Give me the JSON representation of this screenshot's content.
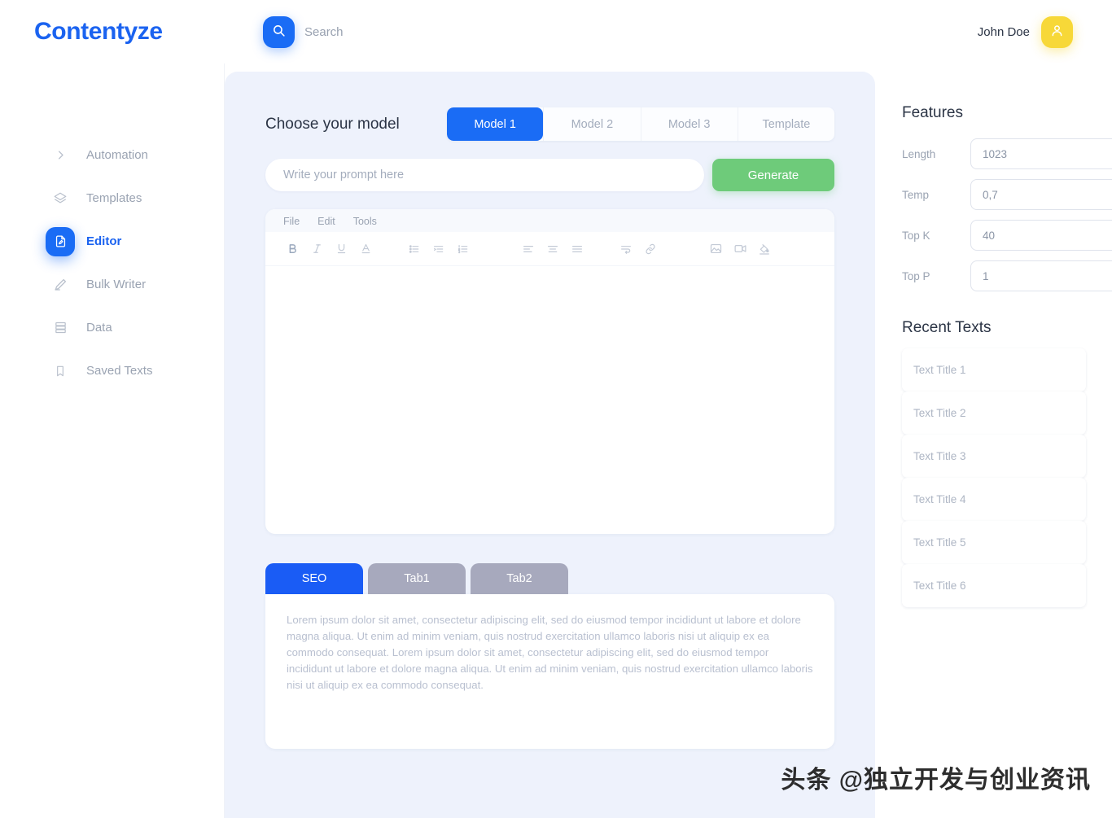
{
  "header": {
    "brand": "Contentyze",
    "search_placeholder": "Search",
    "search_value": "",
    "search_icon": "search-icon",
    "user_name": "John Doe",
    "avatar_icon": "user-icon",
    "brand_color": "#1b63f0",
    "avatar_color": "#f7d838"
  },
  "sidebar": {
    "items": [
      {
        "label": "Automation",
        "icon": "chevron-right-icon",
        "active": false
      },
      {
        "label": "Templates",
        "icon": "layers-icon",
        "active": false
      },
      {
        "label": "Editor",
        "icon": "document-edit-icon",
        "active": true
      },
      {
        "label": "Bulk Writer",
        "icon": "pen-icon",
        "active": false
      },
      {
        "label": "Data",
        "icon": "database-icon",
        "active": false
      },
      {
        "label": "Saved Texts",
        "icon": "bookmark-icon",
        "active": false
      }
    ]
  },
  "main": {
    "model_title": "Choose your model",
    "tabs": [
      {
        "label": "Model 1",
        "active": true
      },
      {
        "label": "Model 2",
        "active": false
      },
      {
        "label": "Model 3",
        "active": false
      },
      {
        "label": "Template",
        "active": false
      }
    ],
    "prompt_placeholder": "Write your prompt here",
    "prompt_value": "",
    "generate_label": "Generate",
    "generate_color": "#6ecb7a",
    "accent_color": "#1a6cf5",
    "editor": {
      "menu": [
        "File",
        "Edit",
        "Tools"
      ],
      "content": "",
      "tools": [
        "bold-icon",
        "italic-icon",
        "underline-icon",
        "text-color-icon",
        "bullet-list-icon",
        "indent-list-icon",
        "numbered-list-icon",
        "align-left-icon",
        "align-center-icon",
        "align-justify-icon",
        "line-wrap-icon",
        "link-icon",
        "image-icon",
        "video-icon",
        "fill-color-icon"
      ]
    },
    "bottom_tabs": [
      {
        "label": "SEO",
        "active": true
      },
      {
        "label": "Tab1",
        "active": false
      },
      {
        "label": "Tab2",
        "active": false
      }
    ],
    "bottom_panel_text": "Lorem ipsum dolor sit amet, consectetur adipiscing elit, sed do eiusmod tempor incididunt ut labore et dolore magna aliqua. Ut enim ad minim veniam, quis nostrud exercitation ullamco laboris nisi ut aliquip ex ea commodo consequat. Lorem ipsum dolor sit amet, consectetur adipiscing elit, sed do eiusmod tempor incididunt ut labore et dolore magna aliqua. Ut enim ad minim veniam, quis nostrud exercitation ullamco laboris nisi ut aliquip ex ea commodo consequat."
  },
  "right": {
    "features_title": "Features",
    "features": [
      {
        "label": "Length",
        "value": "1023"
      },
      {
        "label": "Temp",
        "value": "0,7"
      },
      {
        "label": "Top K",
        "value": "40"
      },
      {
        "label": "Top P",
        "value": "1"
      }
    ],
    "recent_title": "Recent Texts",
    "recent_items": [
      {
        "label": "Text Title 1"
      },
      {
        "label": "Text Title 2"
      },
      {
        "label": "Text Title 3"
      },
      {
        "label": "Text Title 4"
      },
      {
        "label": "Text Title 5"
      },
      {
        "label": "Text Title 6"
      }
    ]
  },
  "watermark": {
    "text": "头条 @独立开发与创业资讯"
  }
}
